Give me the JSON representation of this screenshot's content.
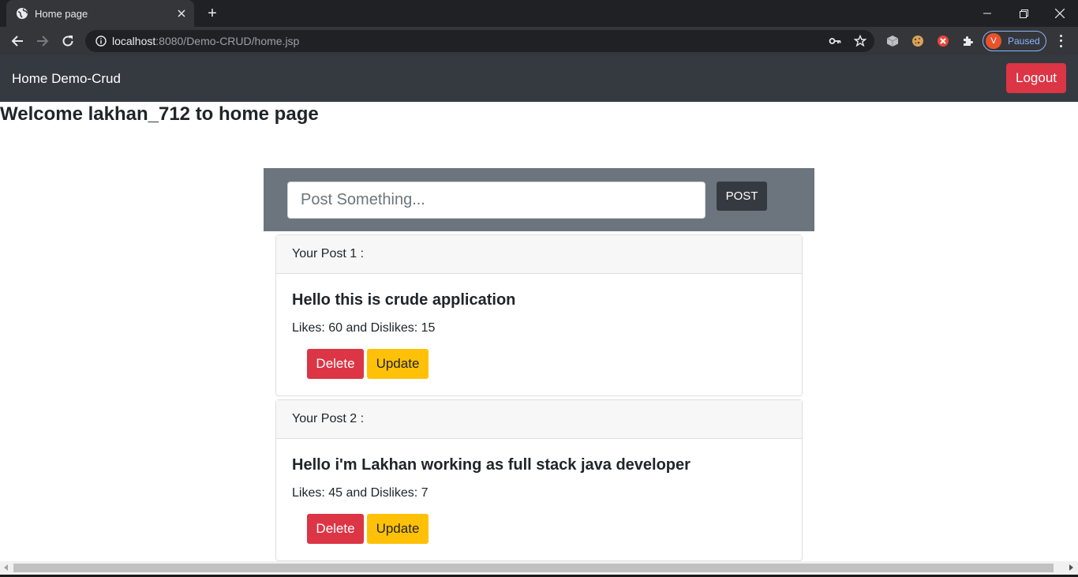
{
  "browser": {
    "tab_title": "Home page",
    "url_host": "localhost",
    "url_rest": ":8080/Demo-CRUD/home.jsp",
    "profile_initial": "V",
    "profile_status": "Paused"
  },
  "navbar": {
    "brand": "Home Demo-Crud",
    "logout_label": "Logout"
  },
  "welcome_text": "Welcome lakhan_712 to home page",
  "composer": {
    "placeholder": "Post Something...",
    "post_label": "POST"
  },
  "posts": [
    {
      "header": "Your Post 1 :",
      "title": "Hello this is crude application",
      "stats": "Likes: 60 and Dislikes: 15",
      "delete_label": "Delete",
      "update_label": "Update"
    },
    {
      "header": "Your Post 2 :",
      "title": "Hello i'm Lakhan working as full stack java developer",
      "stats": "Likes: 45 and Dislikes: 7",
      "delete_label": "Delete",
      "update_label": "Update"
    }
  ],
  "colors": {
    "navbar": "#343a40",
    "danger": "#dc3545",
    "warning": "#ffc107",
    "composer_bg": "#6c757d"
  }
}
